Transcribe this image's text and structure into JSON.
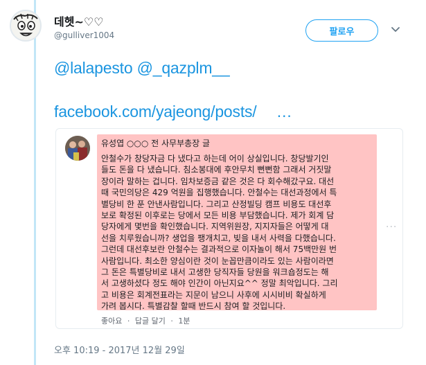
{
  "user": {
    "display_name": "데헷~♡♡",
    "handle": "@gulliver1004"
  },
  "follow_button_label": "팔로우",
  "tweet": {
    "mentions": "@lalapesto @_qazplm__",
    "link_text": "facebook.com/yajeong/posts/",
    "link_ellipsis": "…"
  },
  "embed": {
    "author_line": "유성엽 ○○○ 전 사무부총장 글",
    "body_lines": [
      "안철수가 창당자금 다 냈다고 하는데 어이 상실입니다. 창당발기인",
      "들도 돈을 다 냈습니다. 침소봉대에 후안무치 뻔뻔함 그래서 거짓말",
      "장이라 말하는 겁니다. 임차보증금 같은 것은 다 회수해갔구요. 대선",
      "때 국민의당은 429 억원을 집행했습니다. 안철수는 대선과정에서 특",
      "별당비 한 푼 안낸사람입니다. 그리고 산정빌딩 캠프 비용도 대선후",
      "보로 확정된 이후로는 당에서 모든 비용 부담했습니다. 제가 회계 담",
      "당자에게 몇번을 확인했습니다. 지역위원장, 지지자들은 어떻게 대",
      "선을 치루웠습니까? 생업을 팽개치고, 빚을 내서 사력을 다했습니다.",
      "그런데 대선후보란 안철수는 결과적으로 이자놀이 해서 75백만원 번",
      "사람입니다. 최소한 양심이란 것이 눈꼽만큼이라도 있는 사람이라면",
      "그 돈은 특별당비로 내서 고생한 당직자들 당원을 워크숍정도는 해",
      "서 고생하셨다 정도 해야 인간이 아닌지요^^ 정말 최악입니다. 그리",
      "고 비용은 회계전표라는 지문이 남으니 사후에 시시비비 확실하게",
      "가려 봅시다. 특별감찰 할때 반드시 참여 할 것입니다."
    ],
    "more_dots": "···",
    "like_label": "좋아요",
    "reply_label": "답글 달기",
    "sep": "·",
    "time_ago": "1분"
  },
  "timestamp": "오후 10:19 - 2017년 12월 29일",
  "colors": {
    "link_blue": "#1b95e0",
    "follow_blue": "#1da1f2",
    "thread_line": "#c2e6f7",
    "highlight_pink": "#ffc4c4"
  },
  "icons": {
    "avatar": "cartoon-face-icon",
    "caret": "chevron-down-icon",
    "fb_avatar": "group-photo-icon"
  }
}
